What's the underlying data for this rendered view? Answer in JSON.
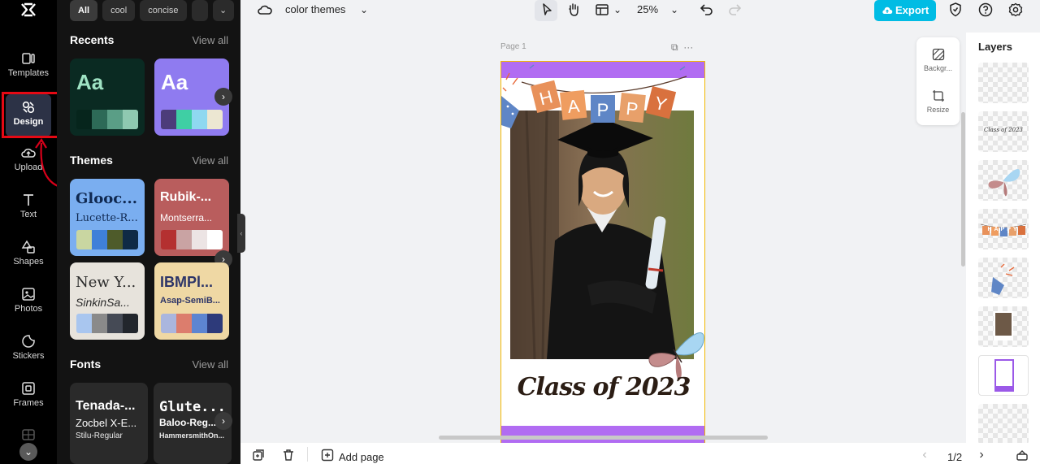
{
  "rail": {
    "items": [
      {
        "label": "Templates",
        "icon": "templates-icon"
      },
      {
        "label": "Design",
        "icon": "design-icon"
      },
      {
        "label": "Upload",
        "icon": "upload-icon"
      },
      {
        "label": "Text",
        "icon": "text-icon"
      },
      {
        "label": "Shapes",
        "icon": "shapes-icon"
      },
      {
        "label": "Photos",
        "icon": "photos-icon"
      },
      {
        "label": "Stickers",
        "icon": "stickers-icon"
      },
      {
        "label": "Frames",
        "icon": "frames-icon"
      }
    ],
    "highlight_color": "#e50914"
  },
  "panel": {
    "chips": [
      "All",
      "cool",
      "concise"
    ],
    "recents": {
      "title": "Recents",
      "view_all": "View all",
      "cards": [
        {
          "aa": "Aa",
          "bg": "#0a2a22",
          "aa_color": "#9fe3c4",
          "swatches": [
            "#06251c",
            "#2d6a57",
            "#5a9e86",
            "#8fc9b1"
          ]
        },
        {
          "aa": "Aa",
          "bg": "#8f7bf0",
          "aa_color": "#ffffff",
          "swatches": [
            "#4c3c7a",
            "#3fcfa4",
            "#8fd8f0",
            "#ece7d2"
          ]
        }
      ]
    },
    "themes": {
      "title": "Themes",
      "view_all": "View all",
      "cards": [
        {
          "name": "Glooc...",
          "sub": "Lucette-R...",
          "bg": "#7aaef0",
          "fg": "#0f2850",
          "swatches": [
            "#c9d6a1",
            "#3f80d9",
            "#4e5b2a",
            "#0f2a45"
          ]
        },
        {
          "name": "Rubik-...",
          "sub": "Montserra...",
          "bg": "#b95d5d",
          "fg": "#ffffff",
          "swatches": [
            "#b43030",
            "#c9a3a3",
            "#ece4e4",
            "#ffffff"
          ]
        },
        {
          "name": "New Y...",
          "sub": "SinkinSa...",
          "bg": "#e7e3dc",
          "fg": "#2a2a2a",
          "swatches": [
            "#a9c6ef",
            "#8a8a8a",
            "#454a55",
            "#22262c"
          ]
        },
        {
          "name": "IBMPl...",
          "sub": "Asap-SemiB...",
          "bg": "#efd8a4",
          "fg": "#2d3568",
          "swatches": [
            "#aab6de",
            "#dc7d6d",
            "#5d85d1",
            "#2d3a7a"
          ]
        }
      ]
    },
    "fonts": {
      "title": "Fonts",
      "view_all": "View all",
      "cards": [
        {
          "l1": "Tenada-...",
          "l2": "Zocbel X-E...",
          "l3": "Stilu-Regular"
        },
        {
          "l1": "Glute...",
          "l2": "Baloo-Reg...",
          "l3": "HammersmithOn..."
        }
      ]
    }
  },
  "topbar": {
    "title": "color themes",
    "zoom": "25%",
    "export_label": "Export",
    "export_color": "#00bce4"
  },
  "canvas": {
    "page_label": "Page 1",
    "banner_letters": [
      "H",
      "A",
      "P",
      "P",
      "Y"
    ],
    "banner_colors": [
      "#e8915a",
      "#ef9d60",
      "#5f86c6",
      "#e8a06a",
      "#d9713e"
    ],
    "headline": "Class of 2023",
    "band_color": "#b16cf2"
  },
  "float_panel": {
    "background": "Backgr...",
    "resize": "Resize"
  },
  "layers": {
    "title": "Layers",
    "caption_thumb": "Class of 2023",
    "banner_thumb": "HAPPY"
  },
  "bottombar": {
    "add_page": "Add page",
    "pager": "1/2"
  }
}
